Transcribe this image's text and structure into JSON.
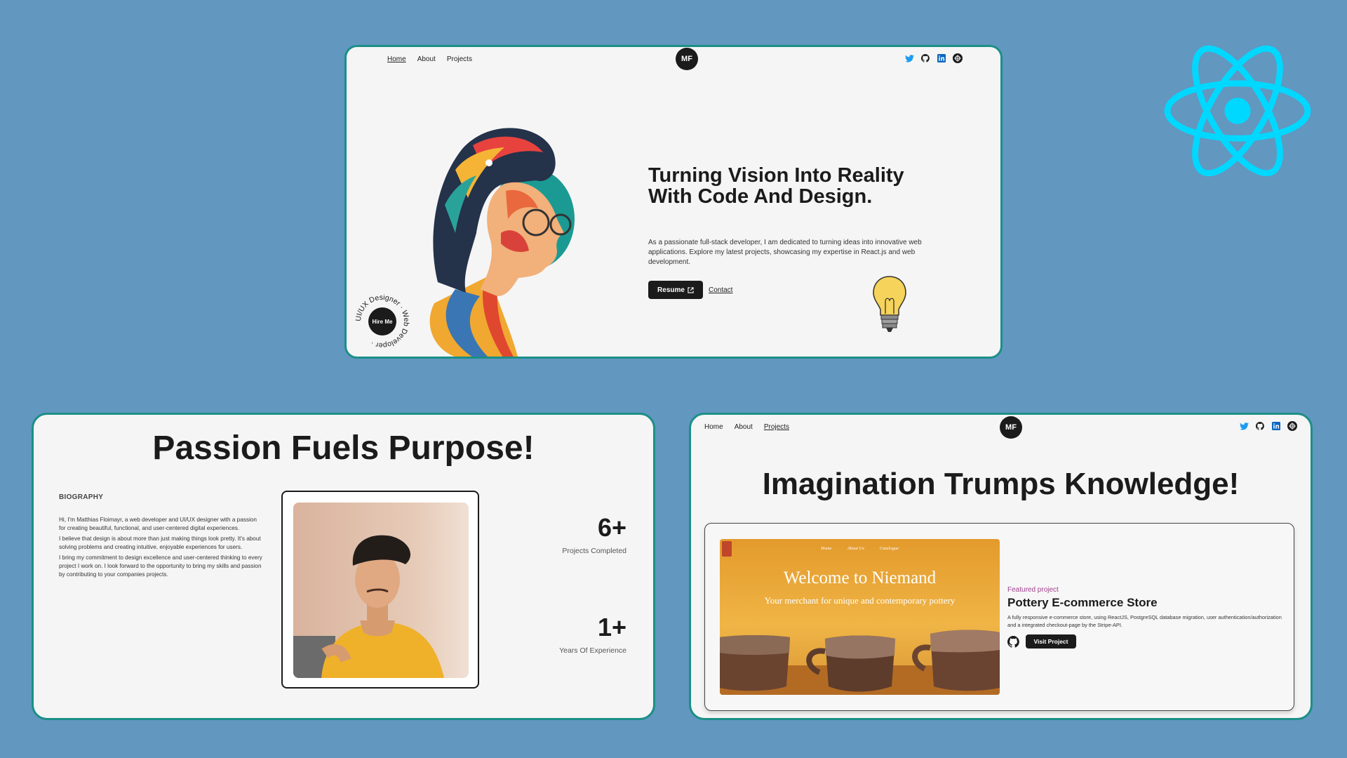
{
  "hero": {
    "nav": [
      "Home",
      "About",
      "Projects"
    ],
    "logo": "MF",
    "title": "Turning Vision Into Reality With Code And Design.",
    "description": "As a passionate full-stack developer, I am dedicated to turning ideas into innovative web applications. Explore my latest projects, showcasing my expertise in React.js and web development.",
    "resume_label": "Resume",
    "contact_label": "Contact",
    "hire_me_label": "Hire Me",
    "badge_ring_text": "UI/UX Designer · Web Developer ·"
  },
  "about": {
    "title": "Passion Fuels Purpose!",
    "bio_heading": "BIOGRAPHY",
    "bio_paragraphs": [
      "Hi, I'm Matthias Floimayr, a web developer and UI/UX designer with a passion for creating beautiful, functional, and user-centered digital experiences.",
      "I believe that design is about more than just making things look pretty. It's about solving problems and creating intuitive, enjoyable experiences for users.",
      "I bring my commitment to design excellence and user-centered thinking to every project I work on. I look forward to the opportunity to bring my skills and passion by contributing to your companies projects."
    ],
    "stats": [
      {
        "value": "6+",
        "label": "Projects Completed"
      },
      {
        "value": "1+",
        "label": "Years Of Experience"
      }
    ]
  },
  "projects": {
    "nav": [
      "Home",
      "About",
      "Projects"
    ],
    "logo": "MF",
    "title": "Imagination Trumps Knowledge!",
    "featured": {
      "label": "Featured project",
      "name": "Pottery E-commerce Store",
      "description": "A fully responsive e-commerce store, using ReactJS, PostgreSQL database migration, user authentication/authorization and a integrated checkout-page by the Stripe-API.",
      "button": "Visit Project",
      "screenshot": {
        "nav": [
          "Home",
          "About Us",
          "Catalogue"
        ],
        "headline": "Welcome to Niemand",
        "subline": "Your merchant for unique and contemporary pottery"
      }
    }
  },
  "colors": {
    "background": "#6297c0",
    "card_border": "#1b8f87",
    "dark": "#1b1b1b",
    "react_logo": "#00d8ff",
    "featured_label": "#a0418f"
  },
  "icons": [
    "twitter-icon",
    "github-icon",
    "linkedin-icon",
    "dribbble-icon",
    "react-logo-icon",
    "external-link-icon",
    "lightbulb-icon"
  ]
}
